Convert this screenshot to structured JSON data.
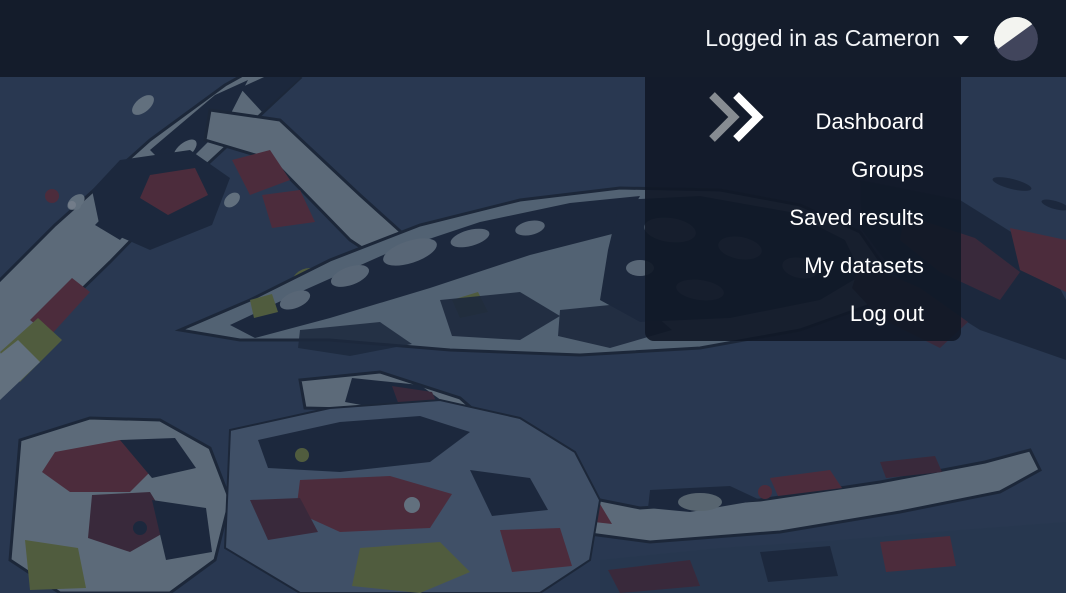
{
  "page": {
    "background_color": "#2a394d",
    "topbar_color": "#141c2b",
    "dropdown_color": "#111827",
    "text_color": "#ffffff"
  },
  "topbar": {
    "user_label": "Logged in as Cameron",
    "caret_icon": "chevron-down-icon",
    "avatar_icon": "avatar-half-circle-icon",
    "avatar_light_color": "#f3f4f0",
    "avatar_dark_color": "#41455c"
  },
  "dropdown": {
    "chevrons_icon": "double-chevron-right-icon",
    "chevron_back_color": "#878c92",
    "chevron_front_color": "#ffffff",
    "items": [
      {
        "label": "Dashboard",
        "name": "menu-item-dashboard"
      },
      {
        "label": "Groups",
        "name": "menu-item-groups"
      },
      {
        "label": "Saved results",
        "name": "menu-item-saved-results"
      },
      {
        "label": "My datasets",
        "name": "menu-item-my-datasets"
      },
      {
        "label": "Log out",
        "name": "menu-item-log-out"
      }
    ]
  },
  "background_art": {
    "subject": "stylized posterized beetle illustration",
    "palette": {
      "base": "#32435c",
      "pale": "#c4d0cf",
      "dark": "#121a28",
      "red": "#8e2327",
      "deep_red": "#5d1c22",
      "olive": "#9aa02a",
      "mauve": "#8a6b72",
      "outline": "#10161f"
    }
  }
}
